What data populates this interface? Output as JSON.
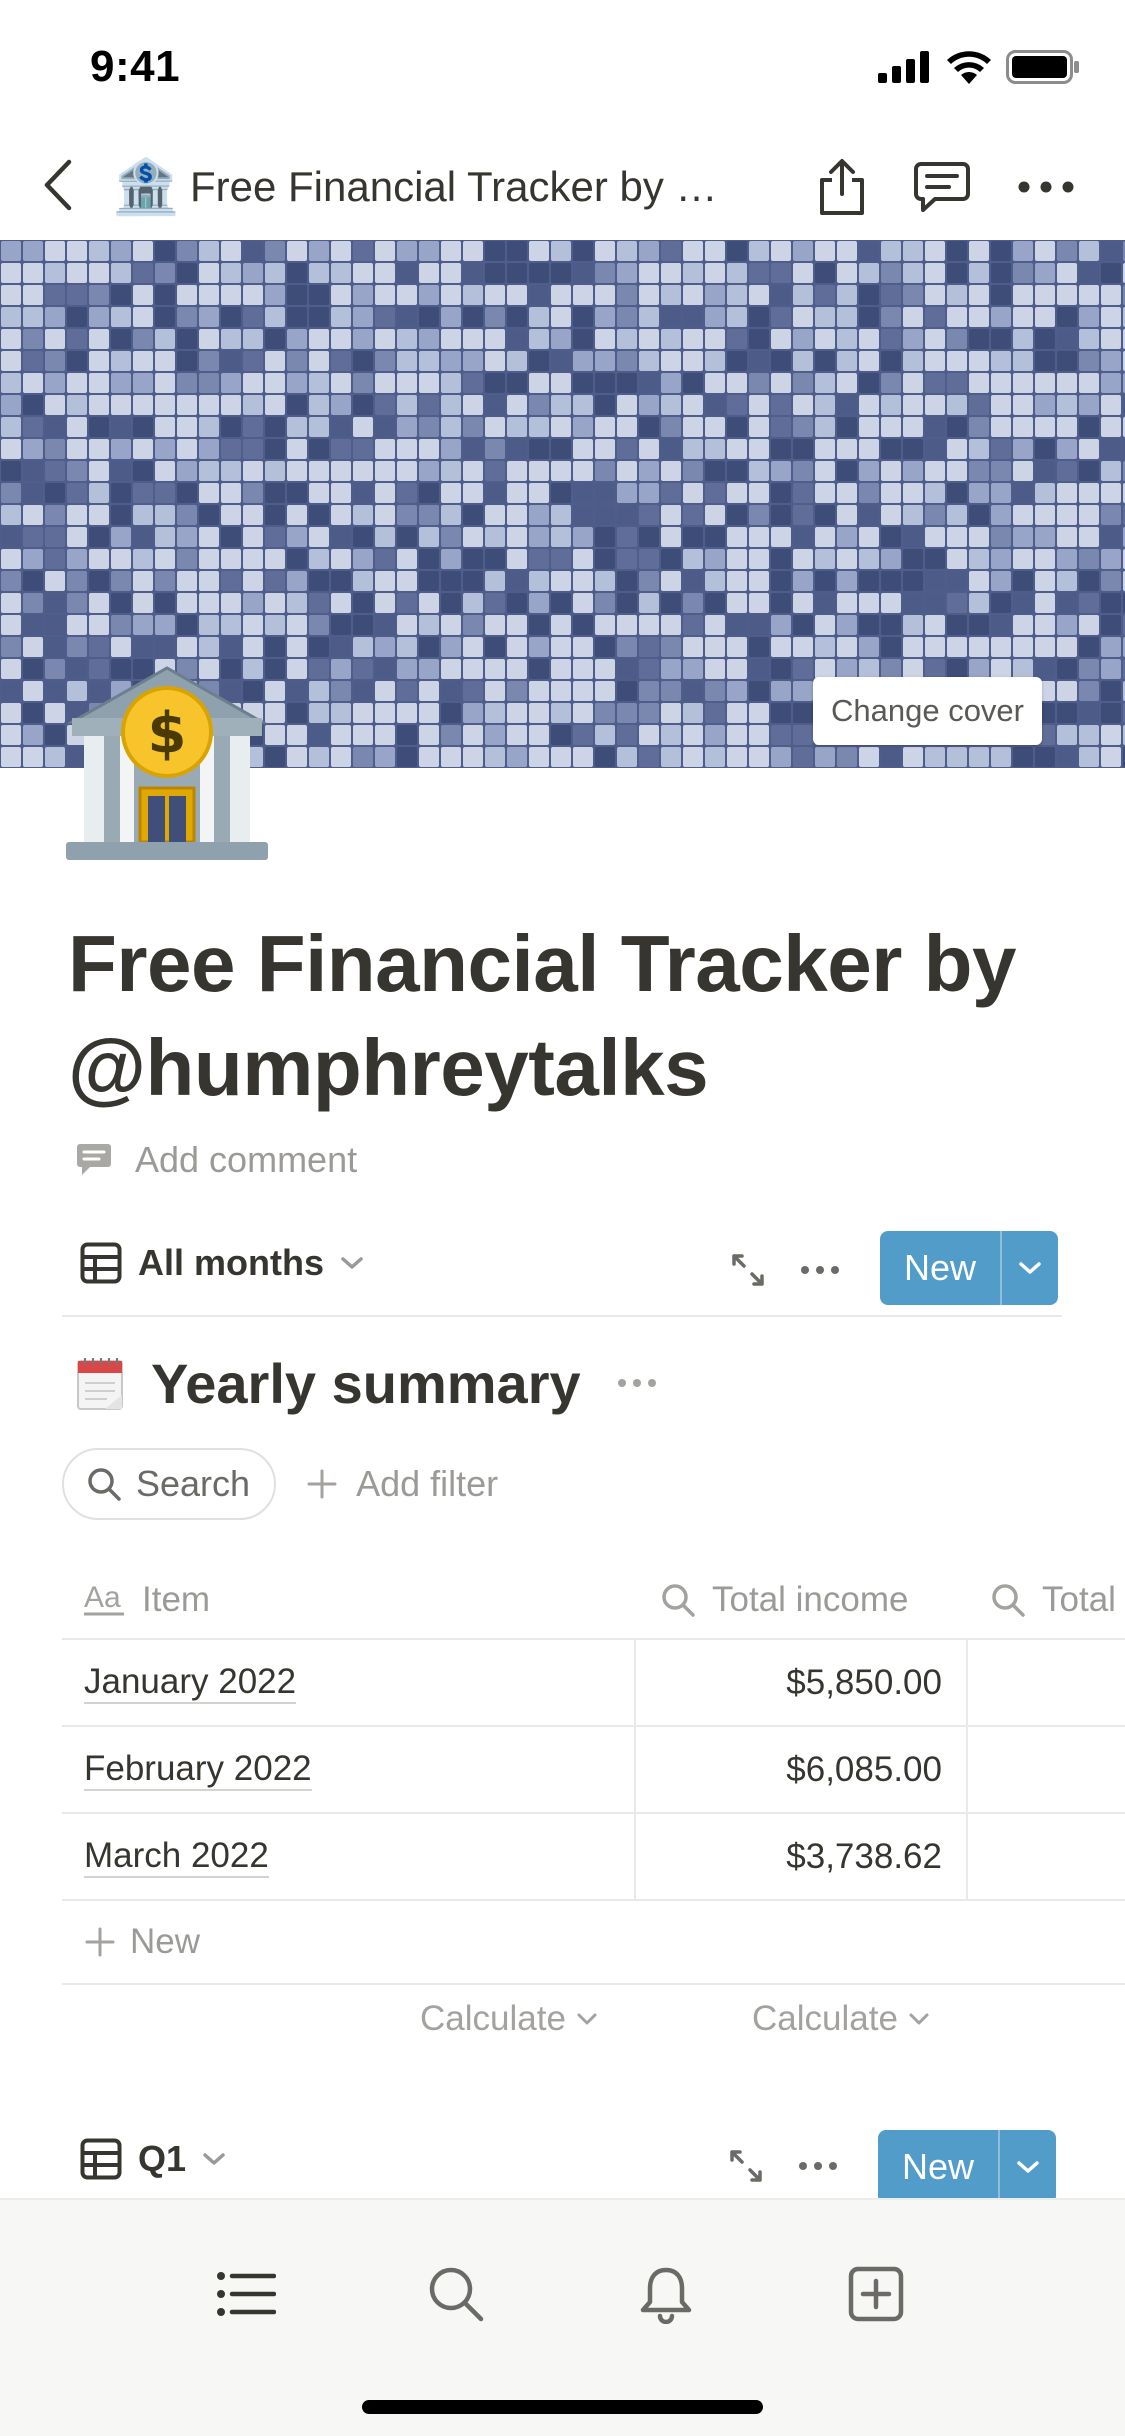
{
  "status_bar": {
    "time": "9:41"
  },
  "nav": {
    "page_emoji": "🏦",
    "title": "Free Financial Tracker by @humphreytalks"
  },
  "cover": {
    "change_cover_label": "Change cover"
  },
  "page": {
    "emoji": "🏦",
    "title": "Free Financial Tracker by @humphreytalks",
    "add_comment_label": "Add comment"
  },
  "database": {
    "view_label": "All months",
    "new_label": "New",
    "title": "Yearly summary",
    "search_label": "Search",
    "add_filter_label": "Add filter",
    "columns": [
      "Item",
      "Total income",
      "Total"
    ],
    "rows": [
      {
        "item": "January 2022",
        "total_income": "$5,850.00"
      },
      {
        "item": "February 2022",
        "total_income": "$6,085.00"
      },
      {
        "item": "March 2022",
        "total_income": "$3,738.62"
      }
    ],
    "add_row_label": "New",
    "calculate_labels": [
      "Calculate",
      "Calculate"
    ]
  },
  "q1": {
    "view_label": "Q1",
    "new_label": "New"
  },
  "colors": {
    "accent_blue": "#529cca",
    "text_primary": "#37352f",
    "text_muted": "#9b9a97",
    "cover_base": "#4f5d8a"
  },
  "icons": {
    "nav": [
      "back-icon",
      "share-icon",
      "comment-icon",
      "more-icon"
    ],
    "tab_bar": [
      "list-icon",
      "search-icon",
      "bell-icon",
      "add-page-icon"
    ]
  }
}
